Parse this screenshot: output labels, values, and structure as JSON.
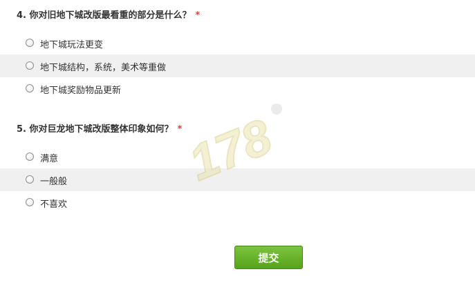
{
  "questions": [
    {
      "title": "4. 你对旧地下城改版最看重的部分是什么？",
      "required_mark": "*",
      "options": [
        "地下城玩法更变",
        "地下城结构，系统，美术等重做",
        "地下城奖励物品更新"
      ]
    },
    {
      "title": "5. 你对巨龙地下城改版整体印象如何？",
      "required_mark": "*",
      "options": [
        "满意",
        "一般般",
        "不喜欢"
      ]
    }
  ],
  "submit_label": "提交",
  "watermark_text": "178",
  "colors": {
    "required": "#e13b3b",
    "alt_row": "#f0f0f0",
    "submit_button": "#67b32c"
  }
}
